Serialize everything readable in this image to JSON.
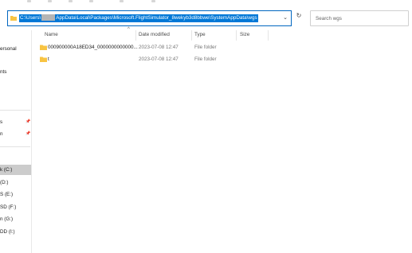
{
  "address_bar": {
    "path_prefix": "C:\\Users\\",
    "path_suffix": "AppData\\Local\\Packages\\Microsoft.FlightSimulator_8wekyb3d8bbwe\\SystemAppData\\wgs"
  },
  "search": {
    "placeholder": "Search wgs"
  },
  "sidebar": {
    "items": [
      {
        "label": "ersonal",
        "pinned": false
      },
      {
        "label": "nts",
        "pinned": false
      },
      {
        "label": "s",
        "pinned": true
      },
      {
        "label": "n",
        "pinned": true
      },
      {
        "label": "k (C:)",
        "pinned": false,
        "selected": true
      },
      {
        "label": "(D:)",
        "pinned": false
      },
      {
        "label": "S (E:)",
        "pinned": false
      },
      {
        "label": "SD (F:)",
        "pinned": false
      },
      {
        "label": "n (G:)",
        "pinned": false
      },
      {
        "label": "DD (I:)",
        "pinned": false
      }
    ]
  },
  "columns": {
    "name": "Name",
    "date": "Date modified",
    "type": "Type",
    "size": "Size"
  },
  "rows": [
    {
      "name": "000900000A18ED34_0000000000000...",
      "date": "2023-07-08 12:47",
      "type": "File folder",
      "size": ""
    },
    {
      "name": "t",
      "date": "2023-07-08 12:47",
      "type": "File folder",
      "size": ""
    }
  ],
  "colors": {
    "accent": "#0078d7",
    "folder": "#f8c443",
    "selected_nav": "#cccccc"
  },
  "icons": [
    "folder-icon",
    "chevron-down-icon",
    "refresh-icon",
    "pin-icon",
    "sort-up-icon"
  ]
}
